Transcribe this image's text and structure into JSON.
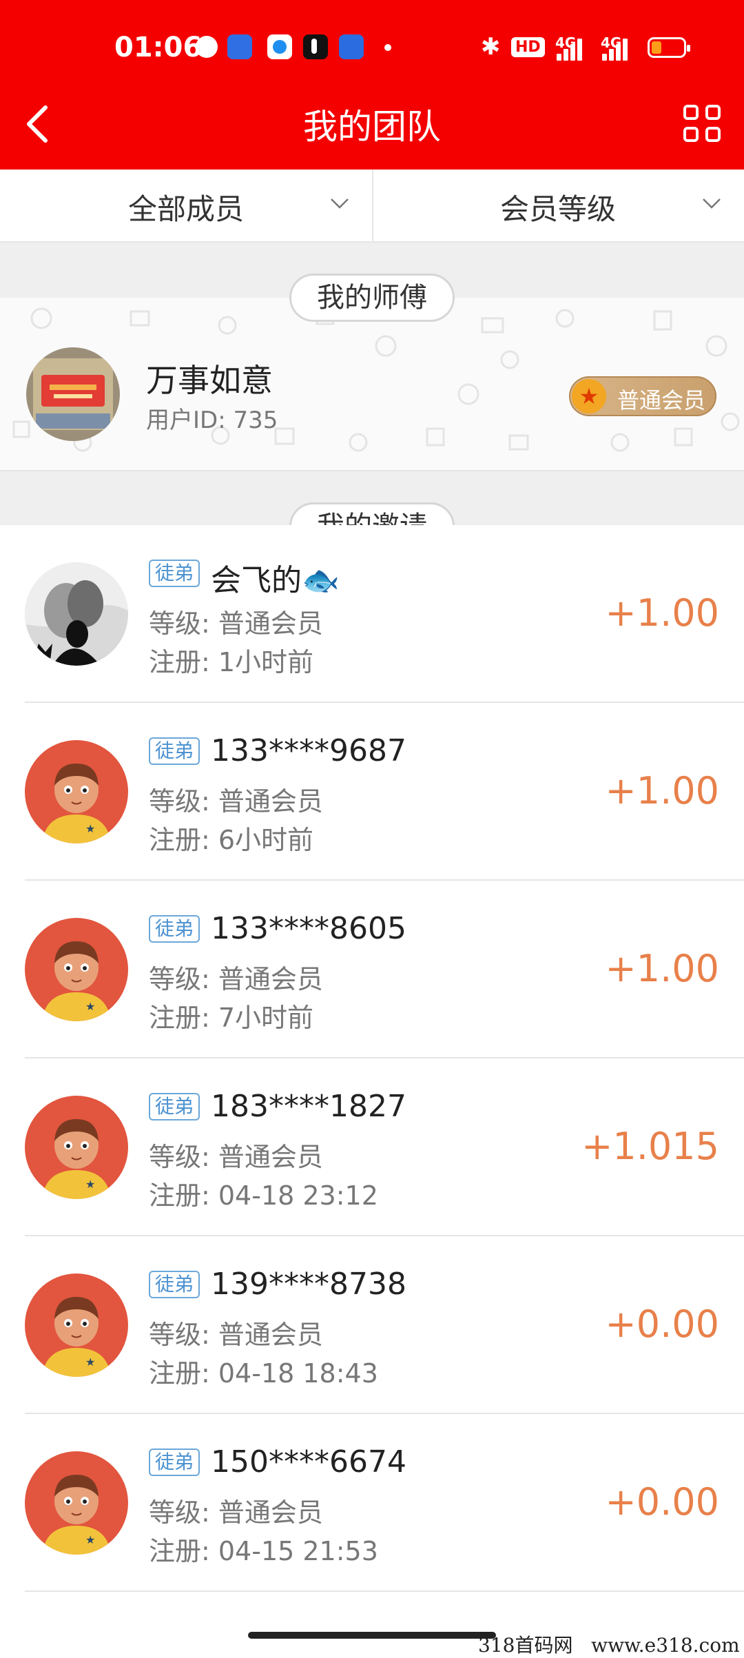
{
  "status_bar": {
    "time": "01:06",
    "hd_label": "HD",
    "network_1": "4G",
    "network_2": "4G",
    "battery_color": "#ff9c1a"
  },
  "header": {
    "title": "我的团队",
    "back_icon": "chevron-left-icon",
    "menu_icon": "grid-icon",
    "bg_color": "#f40000"
  },
  "filters": {
    "all_members": "全部成员",
    "member_level": "会员等级"
  },
  "master_section": {
    "label": "我的师傅",
    "name": "万事如意",
    "user_id": "用户ID: 735",
    "badge": "普通会员"
  },
  "invite_section": {
    "label": "我的邀请",
    "items": [
      {
        "tag": "徒弟",
        "name": "会飞的🐟",
        "level": "等级: 普通会员",
        "registered": "注册: 1小时前",
        "amount": "+1.00"
      },
      {
        "tag": "徒弟",
        "name": "133****9687",
        "level": "等级: 普通会员",
        "registered": "注册: 6小时前",
        "amount": "+1.00"
      },
      {
        "tag": "徒弟",
        "name": "133****8605",
        "level": "等级: 普通会员",
        "registered": "注册: 7小时前",
        "amount": "+1.00"
      },
      {
        "tag": "徒弟",
        "name": "183****1827",
        "level": "等级: 普通会员",
        "registered": "注册: 04-18 23:12",
        "amount": "+1.015"
      },
      {
        "tag": "徒弟",
        "name": "139****8738",
        "level": "等级: 普通会员",
        "registered": "注册: 04-18 18:43",
        "amount": "+0.00"
      },
      {
        "tag": "徒弟",
        "name": "150****6674",
        "level": "等级: 普通会员",
        "registered": "注册: 04-15 21:53",
        "amount": "+0.00"
      }
    ]
  },
  "watermark": "318首码网   www.e318.com",
  "colors": {
    "amount": "#e8804a",
    "tag_border": "#6aa7da",
    "badge_gold": "#c9a06d"
  }
}
